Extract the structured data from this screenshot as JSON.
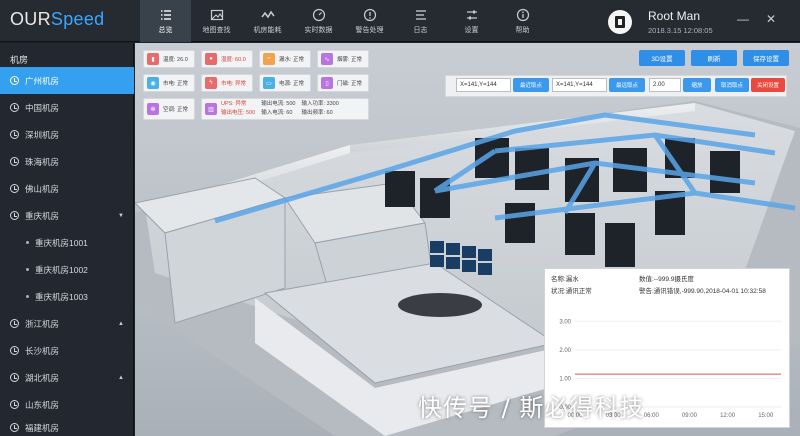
{
  "app": {
    "logo_prefix": "OUR",
    "logo_suffix": "Speed"
  },
  "nav": [
    {
      "label": "总览",
      "icon": "list-icon"
    },
    {
      "label": "地图查找",
      "icon": "image-icon"
    },
    {
      "label": "机房能耗",
      "icon": "pulse-icon"
    },
    {
      "label": "实时数据",
      "icon": "gauge-icon"
    },
    {
      "label": "警告处理",
      "icon": "alert-icon"
    },
    {
      "label": "日志",
      "icon": "log-icon"
    },
    {
      "label": "设置",
      "icon": "sliders-icon"
    },
    {
      "label": "帮助",
      "icon": "help-icon"
    }
  ],
  "user": {
    "name": "Root Man",
    "time": "2018.3.15 12:08:05"
  },
  "window": {
    "minimize": "—",
    "close": "✕"
  },
  "sidebar": {
    "title": "机房",
    "items": [
      {
        "label": "广州机房"
      },
      {
        "label": "中国机房"
      },
      {
        "label": "深圳机房"
      },
      {
        "label": "珠海机房"
      },
      {
        "label": "佛山机房"
      },
      {
        "label": "重庆机房",
        "chevron": "▼"
      },
      {
        "label": "重庆机房1001"
      },
      {
        "label": "重庆机房1002"
      },
      {
        "label": "重庆机房1003"
      },
      {
        "label": "浙江机房",
        "chevron": "▲"
      },
      {
        "label": "长沙机房"
      },
      {
        "label": "湖北机房",
        "chevron": "▲"
      },
      {
        "label": "山东机房"
      },
      {
        "label": "福建机房"
      }
    ]
  },
  "status_cards": [
    {
      "label": "温度: 26.0",
      "color": "#e86a6a"
    },
    {
      "label": "湿度: 60.0",
      "color": "#e86a6a",
      "alert": true
    },
    {
      "label": "漏水: 正常",
      "color": "#f2a24a"
    },
    {
      "label": "烟雾: 正常",
      "color": "#b874e0"
    },
    {
      "label": "市电: 正常",
      "color": "#4ab0e8"
    },
    {
      "label": "市电: 异常",
      "color": "#e86a6a",
      "alert": true
    },
    {
      "label": "电源: 正常",
      "color": "#4ab0e8"
    },
    {
      "label": "门磁: 正常",
      "color": "#b874e0"
    },
    {
      "label": "空调: 正常",
      "color": "#b874e0"
    }
  ],
  "ups_card": {
    "line1": "UPS: 异常",
    "line2": "输出电压: 500",
    "col2_line1": "输出电流: 500",
    "col2_line2": "输入电流: 60",
    "col3_line1": "输入功率: 3300",
    "col3_line2": "输出频率: 60"
  },
  "controls": {
    "btn_3d": "3D设置",
    "btn_refresh": "刷新",
    "btn_save": "保存设置",
    "coord1": "X=141,Y=144",
    "coord1_btn": "最近取点",
    "coord2": "X=141,Y=144",
    "coord2_btn": "最远取点",
    "zoom_value": "2.00",
    "zoom_btn": "缩放",
    "cancel_btn": "取消取点",
    "close_btn": "关闭设置"
  },
  "detail": {
    "name": "名称:漏水",
    "value": "数值:--999.9摄氏度",
    "status": "状况:通讯正常",
    "alarm": "警告:通讯错误,-999.90,2018-04-01 10:32:58"
  },
  "chart_data": {
    "type": "line",
    "x": [
      "00:00",
      "03:00",
      "06:00",
      "09:00",
      "12:00",
      "15:00"
    ],
    "yticks": [
      0.0,
      1.0,
      2.0,
      3.0
    ],
    "ylim": [
      0,
      3.5
    ],
    "series": [
      {
        "values": [
          1.15,
          1.15,
          1.15,
          1.15,
          1.15,
          1.15,
          1.15
        ],
        "color": "#d9534f"
      }
    ]
  },
  "watermark": "快传号 / 斯必得科技"
}
